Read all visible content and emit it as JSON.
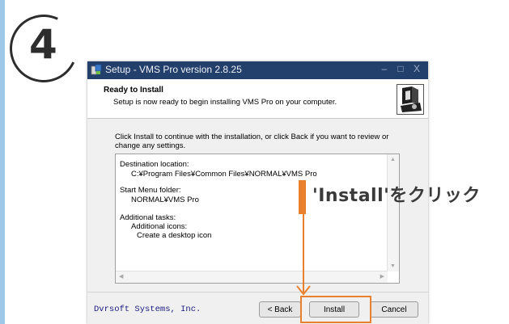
{
  "step": {
    "number": "4"
  },
  "window": {
    "title": "Setup - VMS Pro version 2.8.25",
    "controls": {
      "minimize": "–",
      "maximize": "□",
      "close": "X"
    },
    "header": {
      "title": "Ready to Install",
      "subtitle": "Setup is now ready to begin installing VMS Pro on your computer."
    },
    "intro": "Click Install to continue with the installation, or click Back if you want to review or change any settings.",
    "summary": {
      "dest_label": "Destination location:",
      "dest_value": "C:¥Program Files¥Common Files¥NORMAL¥VMS Pro",
      "menu_label": "Start Menu folder:",
      "menu_value": "NORMAL¥VMS Pro",
      "tasks_label": "Additional tasks:",
      "tasks_sub": "Additional icons:",
      "tasks_item": "Create a desktop icon"
    },
    "brand": "Dvrsoft Systems, Inc.",
    "buttons": {
      "back": "< Back",
      "install": "Install",
      "cancel": "Cancel"
    }
  },
  "annotation": {
    "callout": "'Install'をクリック",
    "color": "#e8802e"
  }
}
